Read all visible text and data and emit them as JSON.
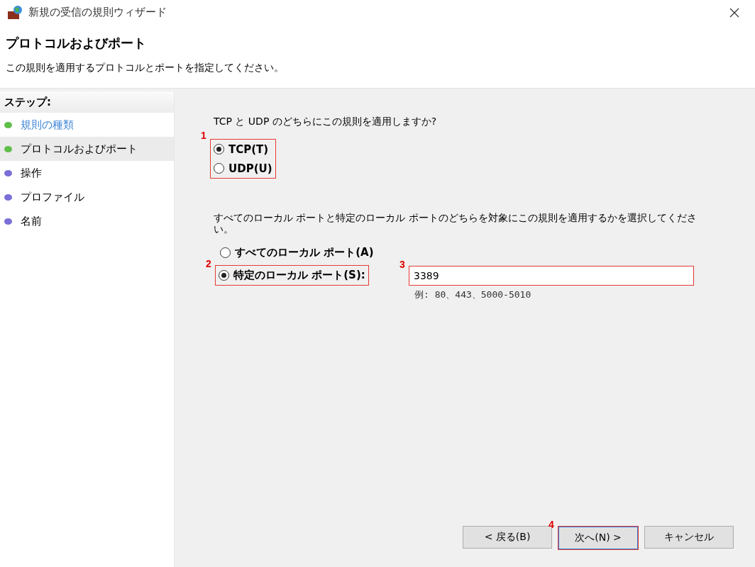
{
  "window": {
    "title": "新規の受信の規則ウィザード"
  },
  "header": {
    "title": "プロトコルおよびポート",
    "description": "この規則を適用するプロトコルとポートを指定してください。"
  },
  "steps": {
    "heading": "ステップ:",
    "items": [
      {
        "label": "規則の種類",
        "color": "#5fbf4a",
        "selected": false,
        "link": true
      },
      {
        "label": "プロトコルおよびポート",
        "color": "#5fbf4a",
        "selected": true,
        "link": false
      },
      {
        "label": "操作",
        "color": "#7a6fd8",
        "selected": false,
        "link": false
      },
      {
        "label": "プロファイル",
        "color": "#7a6fd8",
        "selected": false,
        "link": false
      },
      {
        "label": "名前",
        "color": "#7a6fd8",
        "selected": false,
        "link": false
      }
    ]
  },
  "protocol": {
    "question": "TCP と UDP のどちらにこの規則を適用しますか?",
    "annotation": "1",
    "options": [
      {
        "label": "TCP(T)",
        "selected": true
      },
      {
        "label": "UDP(U)",
        "selected": false
      }
    ]
  },
  "ports": {
    "question": "すべてのローカル ポートと特定のローカル ポートのどちらを対象にこの規則を適用するかを選択してください。",
    "options": [
      {
        "label": "すべてのローカル ポート(A)",
        "selected": false
      },
      {
        "label": "特定のローカル ポート(S):",
        "selected": true,
        "annotation": "2"
      }
    ],
    "field": {
      "value": "3389",
      "annotation": "3"
    },
    "example": "例: 80、443、5000-5010"
  },
  "buttons": [
    {
      "label": "< 戻る(B)",
      "default": false
    },
    {
      "label": "次へ(N) >",
      "default": true,
      "annotation": "4"
    },
    {
      "label": "キャンセル",
      "default": false
    }
  ]
}
